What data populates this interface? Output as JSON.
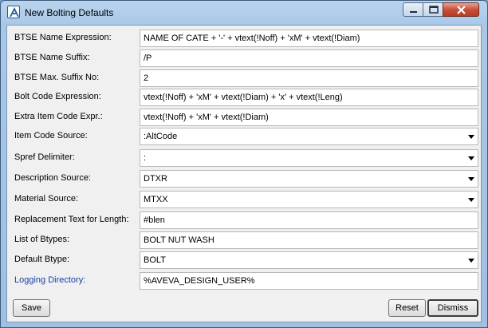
{
  "window": {
    "title": "New Bolting Defaults"
  },
  "form": {
    "rows": [
      {
        "label": "BTSE Name Expression:",
        "value": "NAME OF CATE + '-' + vtext(!Noff) + 'xM' + vtext(!Diam)",
        "type": "text"
      },
      {
        "label": "BTSE Name Suffix:",
        "value": "/P",
        "type": "text"
      },
      {
        "label": "BTSE Max. Suffix No:",
        "value": "2",
        "type": "text"
      },
      {
        "label": "Bolt Code Expression:",
        "value": "vtext(!Noff) + 'xM' + vtext(!Diam) + 'x' + vtext(!Leng)",
        "type": "text"
      },
      {
        "label": "Extra Item Code Expr.:",
        "value": "vtext(!Noff) + 'xM' + vtext(!Diam)",
        "type": "text"
      },
      {
        "label": "Item Code Source:",
        "value": ":AltCode",
        "type": "combo"
      },
      {
        "label": "Spref Delimiter:",
        "value": ":",
        "type": "combo"
      },
      {
        "label": "Description Source:",
        "value": "DTXR",
        "type": "combo"
      },
      {
        "label": "Material Source:",
        "value": "MTXX",
        "type": "combo"
      },
      {
        "label": "Replacement Text for Length:",
        "value": "#blen",
        "type": "text"
      },
      {
        "label": "List of Btypes:",
        "value": "BOLT NUT WASH",
        "type": "text"
      },
      {
        "label": "Default Btype:",
        "value": "BOLT",
        "type": "combo"
      },
      {
        "label": "Logging Directory:",
        "value": "%AVEVA_DESIGN_USER%",
        "type": "text"
      }
    ]
  },
  "buttons": {
    "save": "Save",
    "reset": "Reset",
    "dismiss": "Dismiss"
  },
  "icons": {
    "app": "aveva-logo-icon",
    "minimize": "minimize-icon",
    "maximize": "maximize-icon",
    "close": "close-icon",
    "dropdown": "dropdown-arrow-icon"
  },
  "colors": {
    "link_label": "#1a3fa8",
    "close_button": "#c9503a"
  }
}
